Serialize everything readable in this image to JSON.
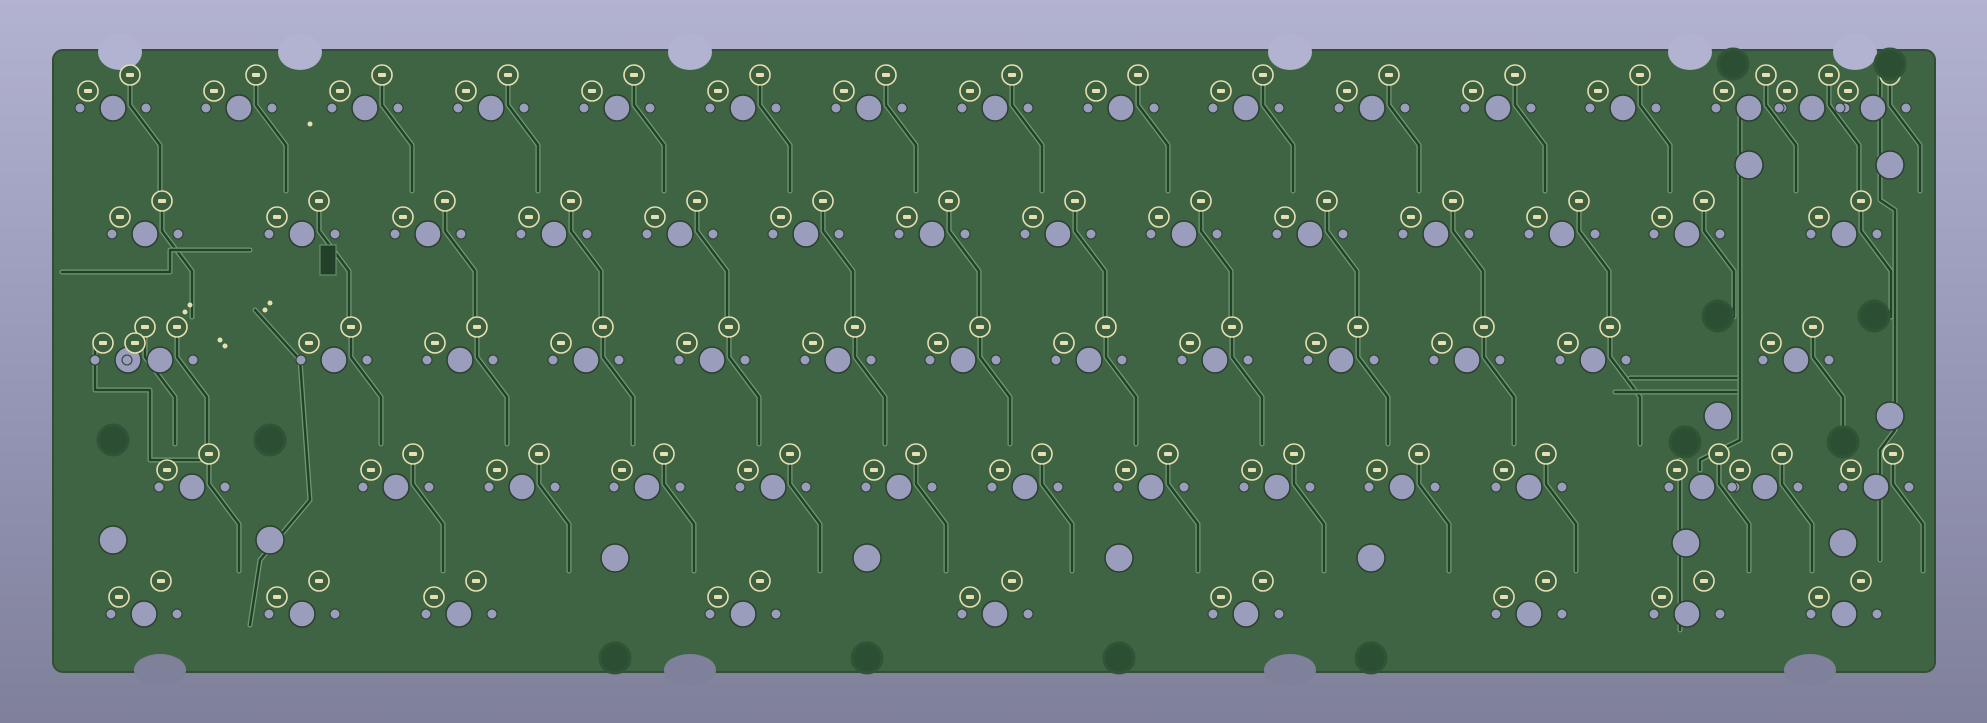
{
  "view": {
    "description_visible_text": "",
    "colors": {
      "background_top": "#b2b3d0",
      "background_bottom": "#7f8099",
      "board": "#3f6443",
      "board_edge": "#324f36",
      "trace": "#23412a",
      "trace_outline": "#6f9a70",
      "hole_fill": "#9b9dbc",
      "hole_stroke": "#2c3f2f",
      "pad_ring": "#e6e0b0",
      "pad_fill": "#3d5f40",
      "mount_ring": "#315436",
      "mount_fill": "#2c4e33"
    }
  }
}
